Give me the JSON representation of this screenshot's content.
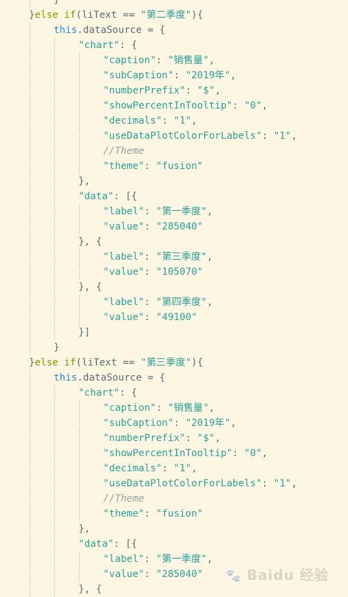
{
  "colors": {
    "background": "#fdf6e3",
    "plain": "#586e75",
    "keyword": "#859900",
    "this": "#268bd2",
    "string": "#2aa198",
    "comment": "#93a1a1"
  },
  "code_lines": [
    {
      "indent": 2,
      "tokens": [
        {
          "t": "}",
          "c": "plain"
        }
      ]
    },
    {
      "indent": 1,
      "tokens": [
        {
          "t": "}",
          "c": "plain"
        },
        {
          "t": "else if",
          "c": "kw"
        },
        {
          "t": "(liText == ",
          "c": "plain"
        },
        {
          "t": "\"第二季度\"",
          "c": "str"
        },
        {
          "t": "){",
          "c": "plain"
        }
      ]
    },
    {
      "indent": 2,
      "tokens": [
        {
          "t": "this",
          "c": "this"
        },
        {
          "t": ".dataSource = {",
          "c": "plain"
        }
      ]
    },
    {
      "indent": 3,
      "tokens": [
        {
          "t": "\"chart\"",
          "c": "str"
        },
        {
          "t": ": {",
          "c": "plain"
        }
      ]
    },
    {
      "indent": 4,
      "tokens": [
        {
          "t": "\"caption\"",
          "c": "str"
        },
        {
          "t": ": ",
          "c": "plain"
        },
        {
          "t": "\"销售量\"",
          "c": "str"
        },
        {
          "t": ",",
          "c": "plain"
        }
      ]
    },
    {
      "indent": 4,
      "tokens": [
        {
          "t": "\"subCaption\"",
          "c": "str"
        },
        {
          "t": ": ",
          "c": "plain"
        },
        {
          "t": "\"2019年\"",
          "c": "str"
        },
        {
          "t": ",",
          "c": "plain"
        }
      ]
    },
    {
      "indent": 4,
      "tokens": [
        {
          "t": "\"numberPrefix\"",
          "c": "str"
        },
        {
          "t": ": ",
          "c": "plain"
        },
        {
          "t": "\"$\"",
          "c": "str"
        },
        {
          "t": ",",
          "c": "plain"
        }
      ]
    },
    {
      "indent": 4,
      "tokens": [
        {
          "t": "\"showPercentInTooltip\"",
          "c": "str"
        },
        {
          "t": ": ",
          "c": "plain"
        },
        {
          "t": "\"0\"",
          "c": "str"
        },
        {
          "t": ",",
          "c": "plain"
        }
      ]
    },
    {
      "indent": 4,
      "tokens": [
        {
          "t": "\"decimals\"",
          "c": "str"
        },
        {
          "t": ": ",
          "c": "plain"
        },
        {
          "t": "\"1\"",
          "c": "str"
        },
        {
          "t": ",",
          "c": "plain"
        }
      ]
    },
    {
      "indent": 4,
      "tokens": [
        {
          "t": "\"useDataPlotColorForLabels\"",
          "c": "str"
        },
        {
          "t": ": ",
          "c": "plain"
        },
        {
          "t": "\"1\"",
          "c": "str"
        },
        {
          "t": ",",
          "c": "plain"
        }
      ]
    },
    {
      "indent": 4,
      "tokens": [
        {
          "t": "//Theme",
          "c": "cm"
        }
      ]
    },
    {
      "indent": 4,
      "tokens": [
        {
          "t": "\"theme\"",
          "c": "str"
        },
        {
          "t": ": ",
          "c": "plain"
        },
        {
          "t": "\"fusion\"",
          "c": "str"
        }
      ]
    },
    {
      "indent": 3,
      "tokens": [
        {
          "t": "},",
          "c": "plain"
        }
      ]
    },
    {
      "indent": 3,
      "tokens": [
        {
          "t": "\"data\"",
          "c": "str"
        },
        {
          "t": ": [{",
          "c": "plain"
        }
      ]
    },
    {
      "indent": 4,
      "tokens": [
        {
          "t": "\"label\"",
          "c": "str"
        },
        {
          "t": ": ",
          "c": "plain"
        },
        {
          "t": "\"第一季度\"",
          "c": "str"
        },
        {
          "t": ",",
          "c": "plain"
        }
      ]
    },
    {
      "indent": 4,
      "tokens": [
        {
          "t": "\"value\"",
          "c": "str"
        },
        {
          "t": ": ",
          "c": "plain"
        },
        {
          "t": "\"285040\"",
          "c": "str"
        }
      ]
    },
    {
      "indent": 3,
      "tokens": [
        {
          "t": "}, {",
          "c": "plain"
        }
      ]
    },
    {
      "indent": 4,
      "tokens": [
        {
          "t": "\"label\"",
          "c": "str"
        },
        {
          "t": ": ",
          "c": "plain"
        },
        {
          "t": "\"第三季度\"",
          "c": "str"
        },
        {
          "t": ",",
          "c": "plain"
        }
      ]
    },
    {
      "indent": 4,
      "tokens": [
        {
          "t": "\"value\"",
          "c": "str"
        },
        {
          "t": ": ",
          "c": "plain"
        },
        {
          "t": "\"105070\"",
          "c": "str"
        }
      ]
    },
    {
      "indent": 3,
      "tokens": [
        {
          "t": "}, {",
          "c": "plain"
        }
      ]
    },
    {
      "indent": 4,
      "tokens": [
        {
          "t": "\"label\"",
          "c": "str"
        },
        {
          "t": ": ",
          "c": "plain"
        },
        {
          "t": "\"第四季度\"",
          "c": "str"
        },
        {
          "t": ",",
          "c": "plain"
        }
      ]
    },
    {
      "indent": 4,
      "tokens": [
        {
          "t": "\"value\"",
          "c": "str"
        },
        {
          "t": ": ",
          "c": "plain"
        },
        {
          "t": "\"49100\"",
          "c": "str"
        }
      ]
    },
    {
      "indent": 3,
      "tokens": [
        {
          "t": "}]",
          "c": "plain"
        }
      ]
    },
    {
      "indent": 2,
      "tokens": [
        {
          "t": "}",
          "c": "plain"
        }
      ]
    },
    {
      "indent": 1,
      "tokens": [
        {
          "t": "}",
          "c": "plain"
        },
        {
          "t": "else if",
          "c": "kw"
        },
        {
          "t": "(liText == ",
          "c": "plain"
        },
        {
          "t": "\"第三季度\"",
          "c": "str"
        },
        {
          "t": "){",
          "c": "plain"
        }
      ]
    },
    {
      "indent": 2,
      "tokens": [
        {
          "t": "this",
          "c": "this"
        },
        {
          "t": ".dataSource = {",
          "c": "plain"
        }
      ]
    },
    {
      "indent": 3,
      "tokens": [
        {
          "t": "\"chart\"",
          "c": "str"
        },
        {
          "t": ": {",
          "c": "plain"
        }
      ]
    },
    {
      "indent": 4,
      "tokens": [
        {
          "t": "\"caption\"",
          "c": "str"
        },
        {
          "t": ": ",
          "c": "plain"
        },
        {
          "t": "\"销售量\"",
          "c": "str"
        },
        {
          "t": ",",
          "c": "plain"
        }
      ]
    },
    {
      "indent": 4,
      "tokens": [
        {
          "t": "\"subCaption\"",
          "c": "str"
        },
        {
          "t": ": ",
          "c": "plain"
        },
        {
          "t": "\"2019年\"",
          "c": "str"
        },
        {
          "t": ",",
          "c": "plain"
        }
      ]
    },
    {
      "indent": 4,
      "tokens": [
        {
          "t": "\"numberPrefix\"",
          "c": "str"
        },
        {
          "t": ": ",
          "c": "plain"
        },
        {
          "t": "\"$\"",
          "c": "str"
        },
        {
          "t": ",",
          "c": "plain"
        }
      ]
    },
    {
      "indent": 4,
      "tokens": [
        {
          "t": "\"showPercentInTooltip\"",
          "c": "str"
        },
        {
          "t": ": ",
          "c": "plain"
        },
        {
          "t": "\"0\"",
          "c": "str"
        },
        {
          "t": ",",
          "c": "plain"
        }
      ]
    },
    {
      "indent": 4,
      "tokens": [
        {
          "t": "\"decimals\"",
          "c": "str"
        },
        {
          "t": ": ",
          "c": "plain"
        },
        {
          "t": "\"1\"",
          "c": "str"
        },
        {
          "t": ",",
          "c": "plain"
        }
      ]
    },
    {
      "indent": 4,
      "tokens": [
        {
          "t": "\"useDataPlotColorForLabels\"",
          "c": "str"
        },
        {
          "t": ": ",
          "c": "plain"
        },
        {
          "t": "\"1\"",
          "c": "str"
        },
        {
          "t": ",",
          "c": "plain"
        }
      ]
    },
    {
      "indent": 4,
      "tokens": [
        {
          "t": "//Theme",
          "c": "cm"
        }
      ]
    },
    {
      "indent": 4,
      "tokens": [
        {
          "t": "\"theme\"",
          "c": "str"
        },
        {
          "t": ": ",
          "c": "plain"
        },
        {
          "t": "\"fusion\"",
          "c": "str"
        }
      ]
    },
    {
      "indent": 3,
      "tokens": [
        {
          "t": "},",
          "c": "plain"
        }
      ]
    },
    {
      "indent": 3,
      "tokens": [
        {
          "t": "\"data\"",
          "c": "str"
        },
        {
          "t": ": [{",
          "c": "plain"
        }
      ]
    },
    {
      "indent": 4,
      "tokens": [
        {
          "t": "\"label\"",
          "c": "str"
        },
        {
          "t": ": ",
          "c": "plain"
        },
        {
          "t": "\"第一季度\"",
          "c": "str"
        },
        {
          "t": ",",
          "c": "plain"
        }
      ]
    },
    {
      "indent": 4,
      "tokens": [
        {
          "t": "\"value\"",
          "c": "str"
        },
        {
          "t": ": ",
          "c": "plain"
        },
        {
          "t": "\"285040\"",
          "c": "str"
        }
      ]
    },
    {
      "indent": 3,
      "tokens": [
        {
          "t": "}, {",
          "c": "plain"
        }
      ]
    }
  ],
  "watermark": {
    "text": "Baidu 经验"
  }
}
